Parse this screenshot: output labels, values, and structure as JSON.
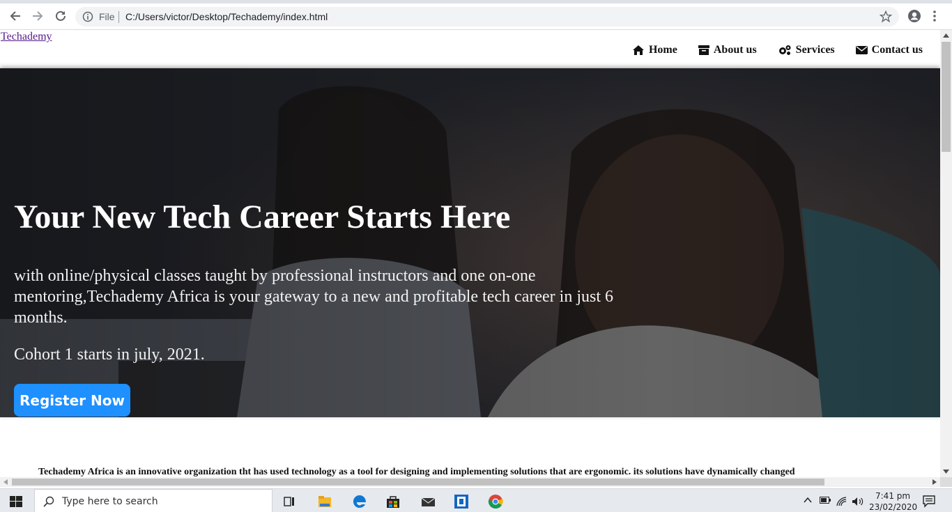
{
  "browser": {
    "scheme_label": "File",
    "url": "C:/Users/victor/Desktop/Techademy/index.html"
  },
  "page": {
    "logo_text": "Techademy",
    "nav": [
      {
        "label": "Home",
        "icon": "home-icon"
      },
      {
        "label": "About us",
        "icon": "archive-icon"
      },
      {
        "label": "Services",
        "icon": "gears-icon"
      },
      {
        "label": "Contact us",
        "icon": "envelope-icon"
      }
    ],
    "hero": {
      "title": "Your New Tech Career Starts Here",
      "text": "with online/physical classes taught by professional instructors and one on-one mentoring,Techademy Africa is your gateway to a new and profitable tech career in just 6 months.",
      "cohort": "Cohort 1 starts in july, 2021.",
      "button": "Register Now",
      "button_color": "#1e90ff"
    },
    "about_text": "Techademy Africa is an innovative organization tht has used technology as a tool for designing and implementing solutions that are ergonomic. its solutions have dynamically changed"
  },
  "taskbar": {
    "search_placeholder": "Type here to search",
    "apps": [
      "task-view-icon",
      "file-explorer-icon",
      "edge-icon",
      "store-icon",
      "mail-icon",
      "app-icon",
      "chrome-icon"
    ],
    "time": "7:41 pm",
    "date": "23/02/2020"
  }
}
